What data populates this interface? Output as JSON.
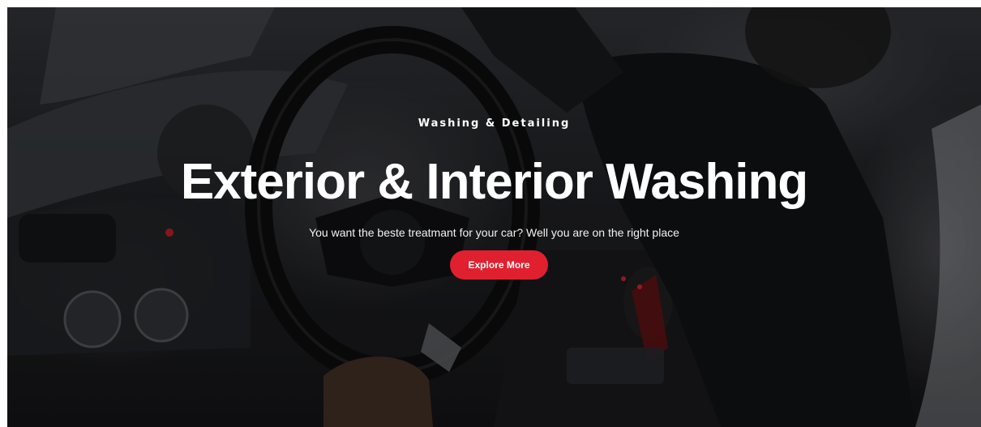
{
  "hero": {
    "eyebrow": "Washing & Detailing",
    "headline": "Exterior & Interior Washing",
    "subline": "You want the beste treatmant for your car? Well you are on the right place",
    "cta_label": "Explore More",
    "background_image": "car-interior-steering-wheel-photo"
  },
  "colors": {
    "accent": "#e0202f",
    "text": "#ffffff"
  }
}
